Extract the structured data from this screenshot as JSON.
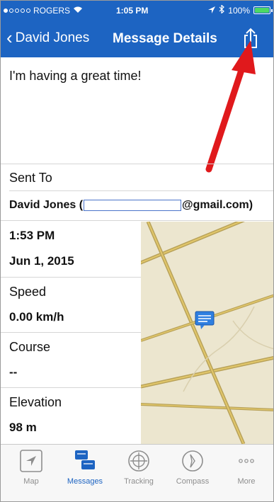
{
  "status_bar": {
    "carrier": "ROGERS",
    "time": "1:05 PM",
    "battery": "100%",
    "battery_level": 1.0
  },
  "nav": {
    "back_label": "David Jones",
    "title": "Message Details",
    "share_icon": "share-icon"
  },
  "message": {
    "text": "I'm having a great time!"
  },
  "sent_to": {
    "label": "Sent To",
    "name_prefix": "David Jones (",
    "email_suffix": "@gmail.com)"
  },
  "details": [
    {
      "label": "1:53 PM",
      "value": "Jun 1, 2015"
    },
    {
      "label": "Speed",
      "value": "0.00 km/h"
    },
    {
      "label": "Course",
      "value": "--"
    },
    {
      "label": "Elevation",
      "value": "98 m"
    }
  ],
  "tabs": [
    {
      "label": "Map",
      "icon": "map-arrow-icon",
      "active": false
    },
    {
      "label": "Messages",
      "icon": "messages-icon",
      "active": true
    },
    {
      "label": "Tracking",
      "icon": "tracking-icon",
      "active": false
    },
    {
      "label": "Compass",
      "icon": "compass-icon",
      "active": false
    },
    {
      "label": "More",
      "icon": "more-icon",
      "active": false
    }
  ],
  "colors": {
    "nav_blue": "#1d64c2",
    "arrow_red": "#e0191c",
    "road": "#c9a94a",
    "map_bg": "#ece6cf"
  }
}
